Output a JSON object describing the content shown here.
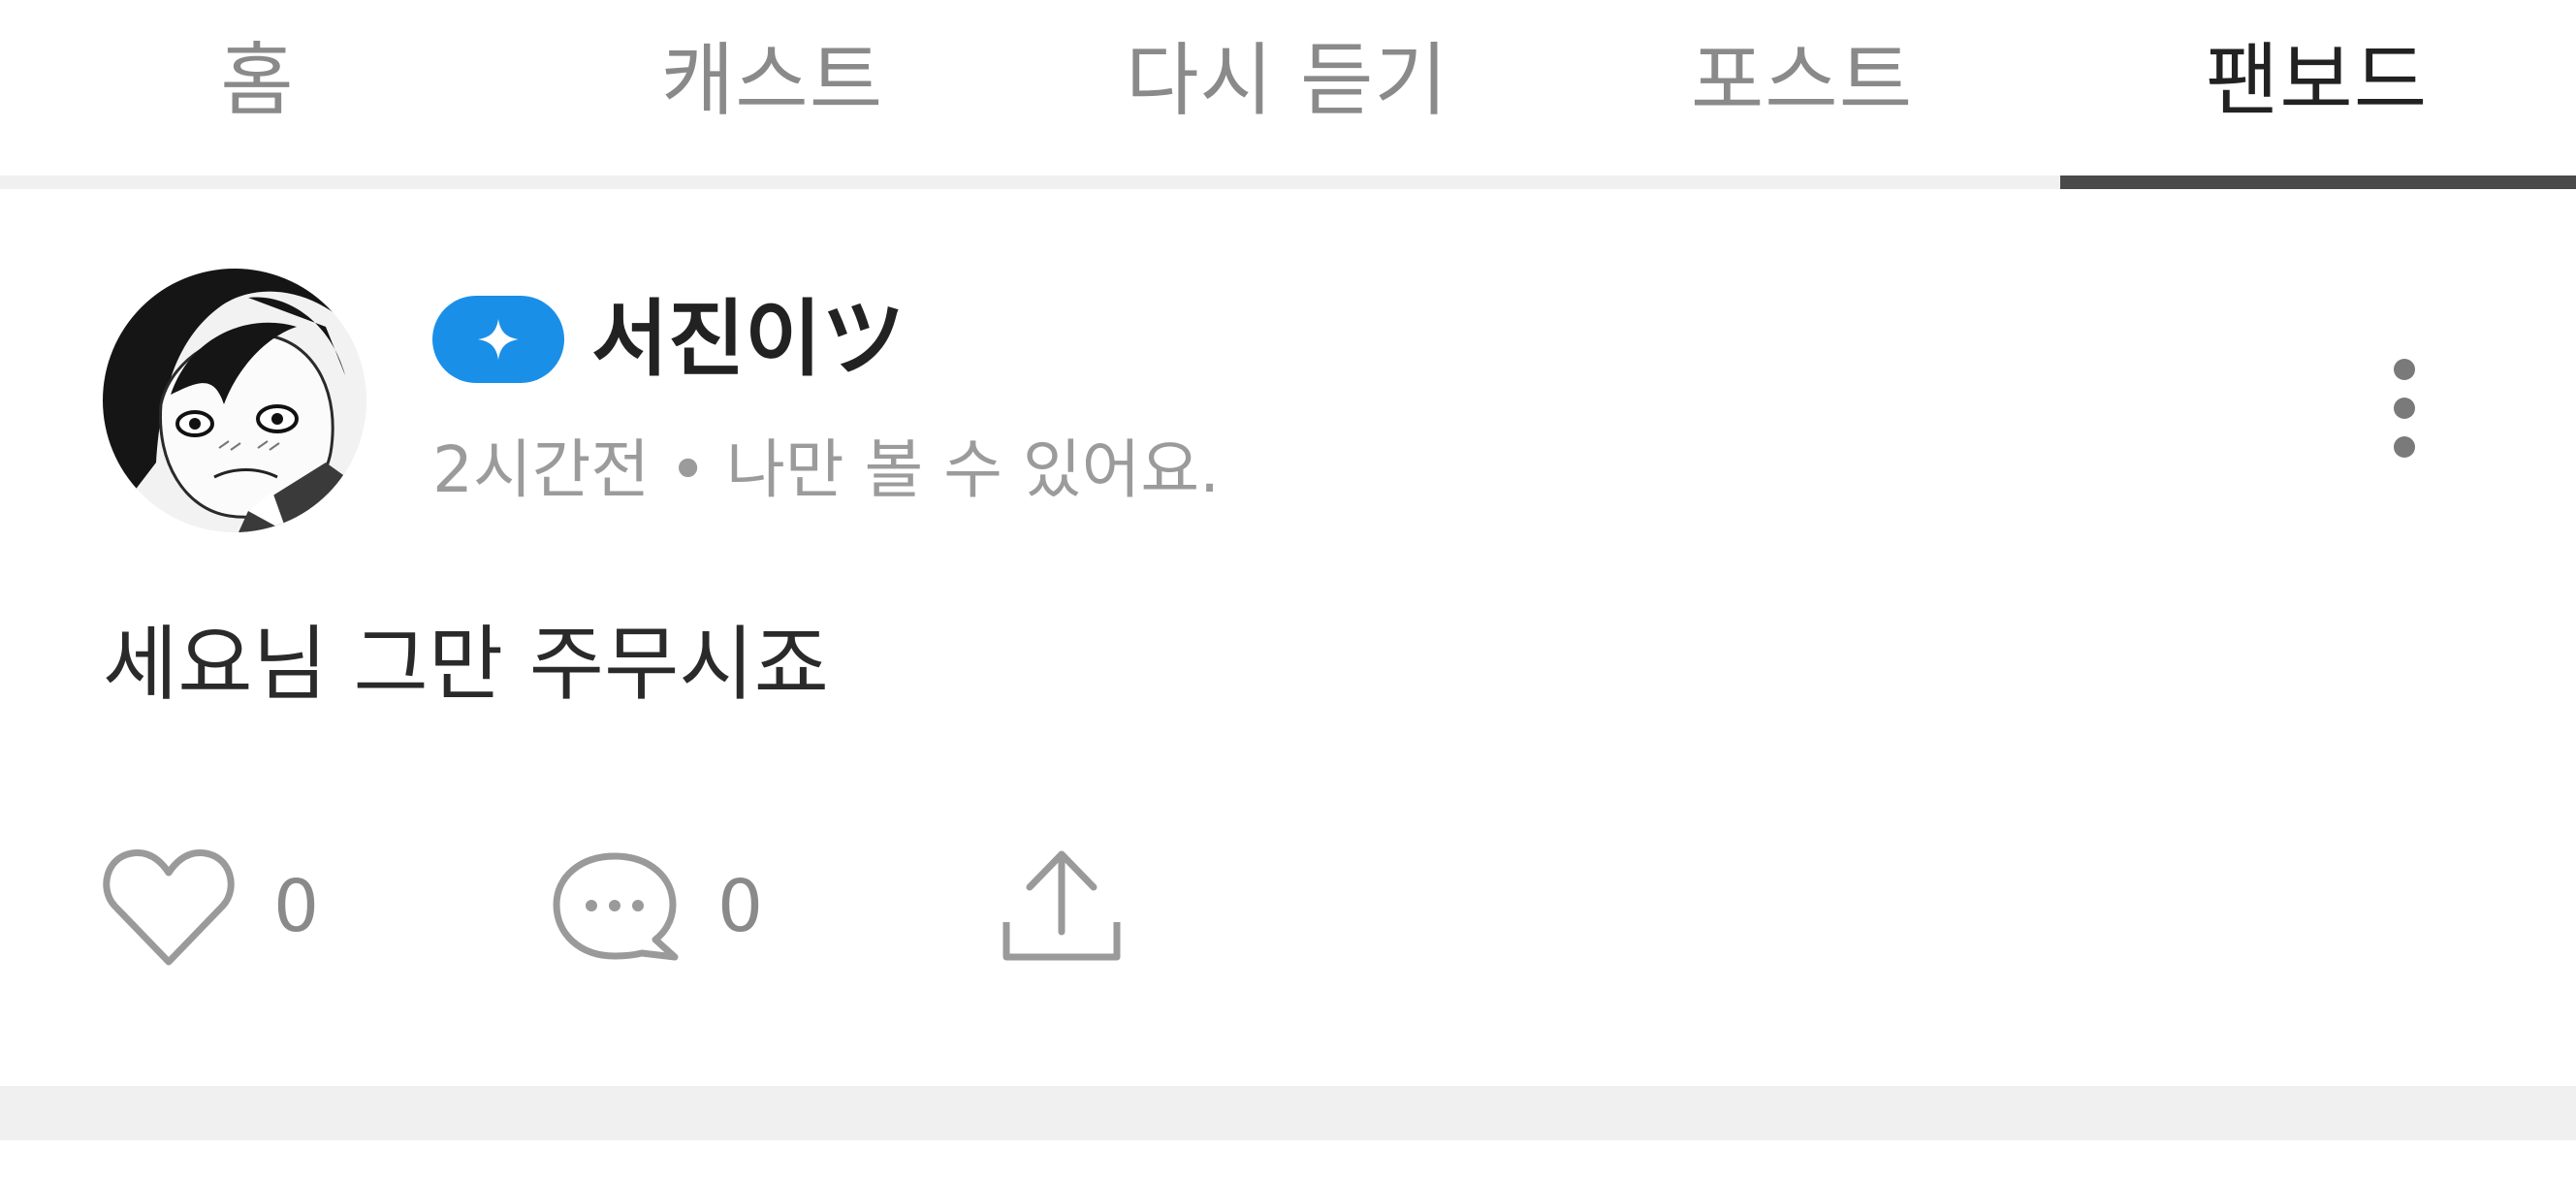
{
  "tabs": [
    {
      "label": "홈",
      "active": false
    },
    {
      "label": "캐스트",
      "active": false
    },
    {
      "label": "다시 듣기",
      "active": false
    },
    {
      "label": "포스트",
      "active": false
    },
    {
      "label": "팬보드",
      "active": true
    }
  ],
  "post": {
    "author": "서진이ツ",
    "badge_icon": "sparkle-icon",
    "badge_color": "#1a8fe8",
    "time": "2시간전",
    "separator": "•",
    "visibility": "나만 볼 수 있어요.",
    "content": "세요님 그만 주무시죠",
    "likes": "0",
    "comments": "0"
  },
  "icons": {
    "like": "heart-icon",
    "comment": "comment-bubble-icon",
    "share": "share-icon",
    "more": "more-vertical-icon"
  }
}
